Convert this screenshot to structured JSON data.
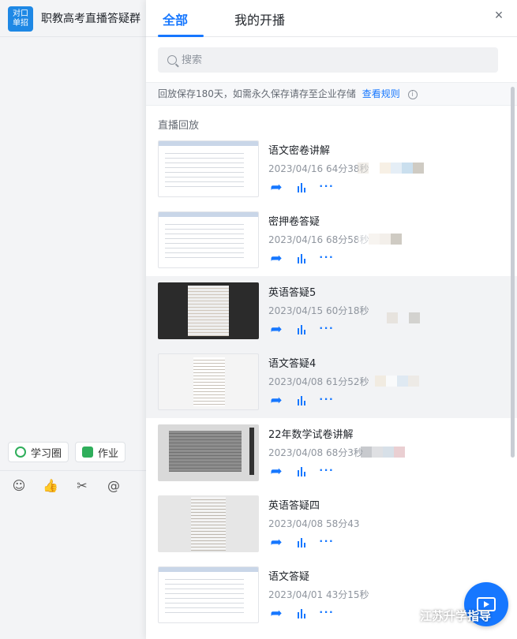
{
  "chat": {
    "group_avatar": "对口\n单招",
    "group_name": "职教高考直播答疑群",
    "quick_actions": [
      {
        "label": "学习圈"
      },
      {
        "label": "作业"
      }
    ]
  },
  "panel": {
    "tabs": [
      {
        "label": "全部"
      },
      {
        "label": "我的开播"
      }
    ],
    "close_glyph": "×",
    "search": {
      "placeholder": "搜索"
    },
    "notice": {
      "text": "回放保存180天，如需永久保存请存至企业存储",
      "link": "查看规则"
    },
    "section_title": "直播回放",
    "items": [
      {
        "title": "语文密卷讲解",
        "meta": "2023/04/16 64分38秒",
        "thumb": "doc"
      },
      {
        "title": "密押卷答疑",
        "meta": "2023/04/16 68分58秒",
        "thumb": "doc"
      },
      {
        "title": "英语答疑5",
        "meta": "2023/04/15 60分18秒",
        "thumb": "dark"
      },
      {
        "title": "语文答疑4",
        "meta": "2023/04/08 61分52秒",
        "thumb": "light"
      },
      {
        "title": "22年数学试卷讲解",
        "meta": "2023/04/08 68分3秒",
        "thumb": "gray"
      },
      {
        "title": "英语答疑四",
        "meta": "2023/04/08 58分43",
        "thumb": "fade"
      },
      {
        "title": "语文答疑",
        "meta": "2023/04/01 43分15秒",
        "thumb": "doc"
      }
    ]
  },
  "watermark": "江苏升学指导",
  "colors": {
    "accent": "#1677ff",
    "muted": "#8f959e"
  }
}
